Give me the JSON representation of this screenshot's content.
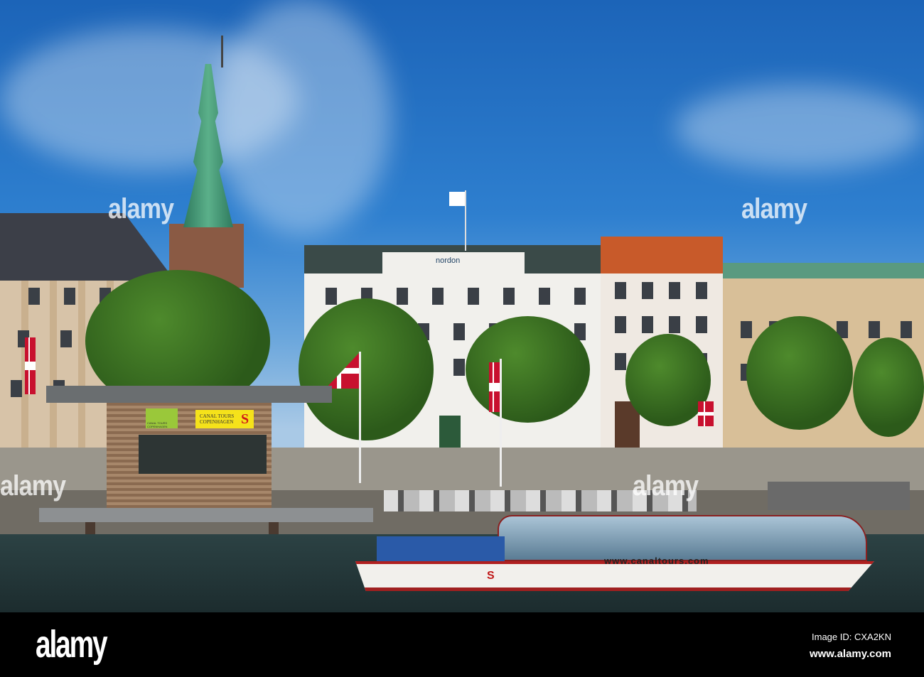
{
  "watermark": {
    "text": "alamy",
    "count": 4
  },
  "signs": {
    "kiosk_left": "CANAL TOURS COPENHAGEN",
    "kiosk_right_line1": "CANAL TOURS",
    "kiosk_right_line2": "COPENHAGEN",
    "kiosk_logo": "S",
    "building_sign": "nordon"
  },
  "boat": {
    "url": "www.canaltours.com",
    "logo": "S"
  },
  "footer": {
    "logo": "alamy",
    "image_id": "Image ID: CXA2KN",
    "site": "www.alamy.com"
  },
  "colors": {
    "sky": "#2e7fcf",
    "water": "#22363a",
    "flag_red": "#c8102e",
    "sign_yellow": "#f5e21a"
  }
}
